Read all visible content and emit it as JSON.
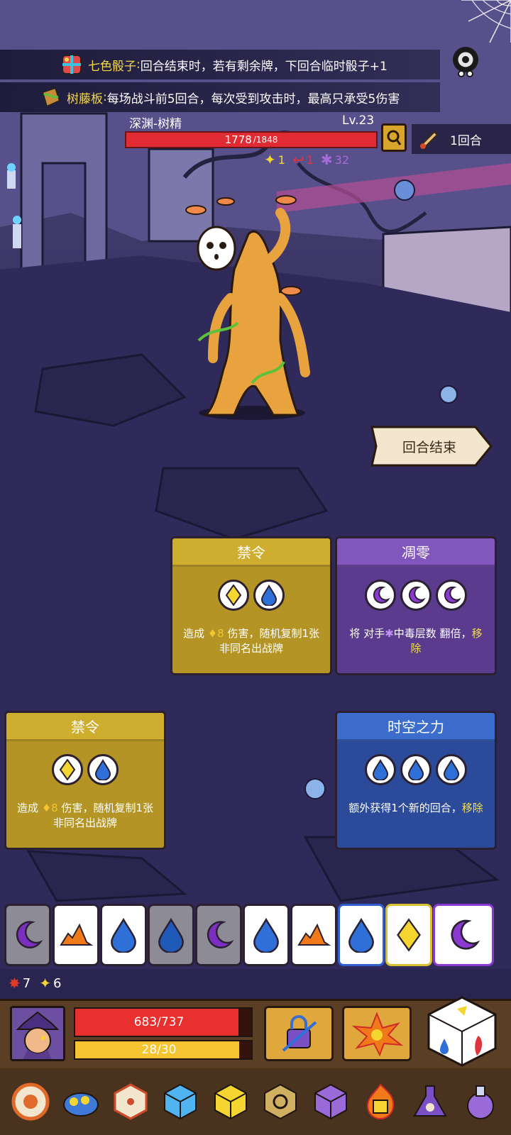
{
  "relics": [
    {
      "name": "七色骰子",
      "colon": ":",
      "desc": " 回合结束时，若有剩余牌，下回合临时骰子+1",
      "icon": "rainbow-dice-icon"
    },
    {
      "name": "树藤板",
      "colon": ":",
      "desc": " 每场战斗前5回合，每次受到攻击时，最高只承受5伤害",
      "icon": "vine-shield-icon"
    }
  ],
  "enemy": {
    "name": "深渊-树精",
    "level": "Lv.23",
    "hp_current": "1778",
    "hp_max": " /1848",
    "hp_fraction": 0.962,
    "statuses": [
      {
        "icon": "star-icon",
        "glyph": "✦",
        "value": "1",
        "color": "#f5d630"
      },
      {
        "icon": "hook-icon",
        "glyph": "↩",
        "value": "1",
        "color": "#e0343c"
      },
      {
        "icon": "poison-icon",
        "glyph": "✱",
        "value": "32",
        "color": "#a86ad8"
      }
    ]
  },
  "round": {
    "label": "1回合"
  },
  "end_turn_label": "回合结束",
  "cards": [
    {
      "title": "禁令",
      "color": "gold",
      "slots": [
        "diamond",
        "drop"
      ],
      "desc_a": "造成 ",
      "value": "♦8",
      "desc_b": " 伤害，随机复制1张非同名出战牌"
    },
    {
      "title": "凋零",
      "color": "purple",
      "slots": [
        "moon",
        "moon",
        "moon"
      ],
      "desc_a": "将 对手",
      "glyph": "✱",
      "desc_b": "中毒层数 翻倍，",
      "remove": "移除"
    },
    {
      "title": "禁令",
      "color": "gold",
      "slots": [
        "diamond",
        "drop"
      ],
      "desc_a": "造成 ",
      "value": "♦8",
      "desc_b": " 伤害，随机复制1张非同名出战牌"
    },
    {
      "title": "时空之力",
      "color": "blue",
      "slots": [
        "drop",
        "drop",
        "drop"
      ],
      "desc_a": "额外获得1个新的回合，",
      "remove": "移除"
    }
  ],
  "dice": [
    "moon-gray",
    "fire",
    "drop",
    "drop-gray",
    "moon-gray",
    "drop",
    "fire",
    "drop-blue",
    "diamond",
    "moon-purple"
  ],
  "counters": [
    {
      "icon": "burst-icon",
      "glyph": "✸",
      "value": "7",
      "color": "#e03a2a"
    },
    {
      "icon": "star-icon",
      "glyph": "✦",
      "value": "6",
      "color": "#f5d630"
    }
  ],
  "player": {
    "hp_label": "683/737",
    "hp_fraction": 0.927,
    "energy_label": "28/30",
    "energy_fraction": 0.933
  },
  "colors": {
    "accent_gold": "#f2d94b",
    "hp_red": "#e02b33",
    "energy_yellow": "#f6c431"
  },
  "inventory": [
    "target-dice-icon",
    "turtle-shell-icon",
    "spiked-dice-icon",
    "ice-dice-icon",
    "gold-dice-icon",
    "rune-dice-icon",
    "purple-dice-icon",
    "flame-dice-icon",
    "eye-flask-icon",
    "potion-flask-icon"
  ]
}
